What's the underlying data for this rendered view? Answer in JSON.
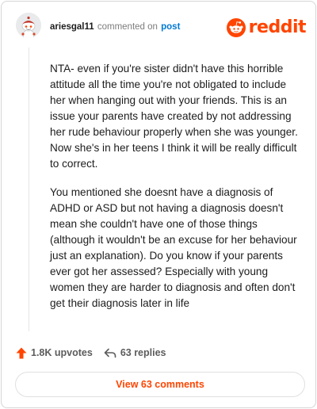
{
  "comment": {
    "username": "ariesgal11",
    "commented_on_text": "commented on",
    "post_link_text": "post",
    "paragraphs": [
      "NTA- even if you're sister didn't have this horrible attitude all the time you're not obligated to include her when hanging out with your friends. This is an issue your parents have created by not addressing her rude behaviour properly when she was younger. Now she's in her teens I think it will be really difficult to correct.",
      "You mentioned she doesnt have a diagnosis of ADHD or ASD but not having a diagnosis doesn't mean she couldn't have one of those things (although it wouldn't be an excuse for her behaviour just an explanation). Do you know if your parents ever got her assessed? Especially with young women they are harder to diagnosis and often don't get their diagnosis later in life"
    ],
    "upvotes": "1.8K upvotes",
    "replies": "63 replies"
  },
  "brand": {
    "wordmark": "reddit",
    "color": "#ff4500"
  },
  "footer": {
    "view_comments_label": "View 63 comments"
  },
  "icons": {
    "avatar": "snoo-avatar",
    "logo": "reddit-snoo-icon",
    "upvote": "upvote-arrow-icon",
    "reply": "reply-arrow-icon"
  },
  "colors": {
    "accent": "#ff4500",
    "link": "#0079d3",
    "text": "#1c1c1c",
    "muted": "#7c7c7c"
  }
}
